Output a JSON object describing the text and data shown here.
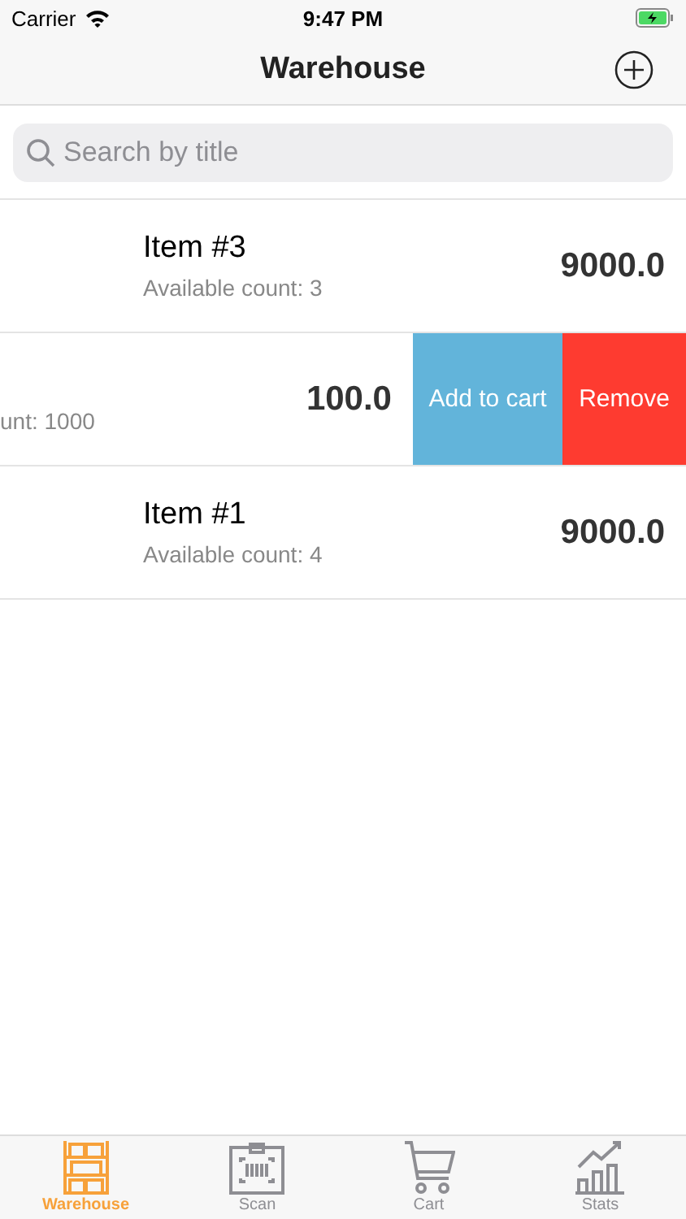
{
  "status_bar": {
    "carrier": "Carrier",
    "time": "9:47 PM"
  },
  "nav": {
    "title": "Warehouse"
  },
  "search": {
    "placeholder": "Search by title"
  },
  "items": [
    {
      "swiped": false,
      "title": "Item #3",
      "subtitle": "Available count: 3",
      "price": "9000.0"
    },
    {
      "swiped": true,
      "subtitle": "unt: 1000",
      "price": "100.0",
      "actions": [
        {
          "label": "Add to cart",
          "color": "#62b4da"
        },
        {
          "label": "Remove",
          "color": "#fe3b30"
        }
      ]
    },
    {
      "swiped": false,
      "title": "Item #1",
      "subtitle": "Available count: 4",
      "price": "9000.0"
    }
  ],
  "tabs": [
    {
      "label": "Warehouse",
      "kind": "shelf",
      "selected": true
    },
    {
      "label": "Scan",
      "kind": "scan",
      "selected": false
    },
    {
      "label": "Cart",
      "kind": "cart",
      "selected": false
    },
    {
      "label": "Stats",
      "kind": "stats",
      "selected": false
    }
  ]
}
